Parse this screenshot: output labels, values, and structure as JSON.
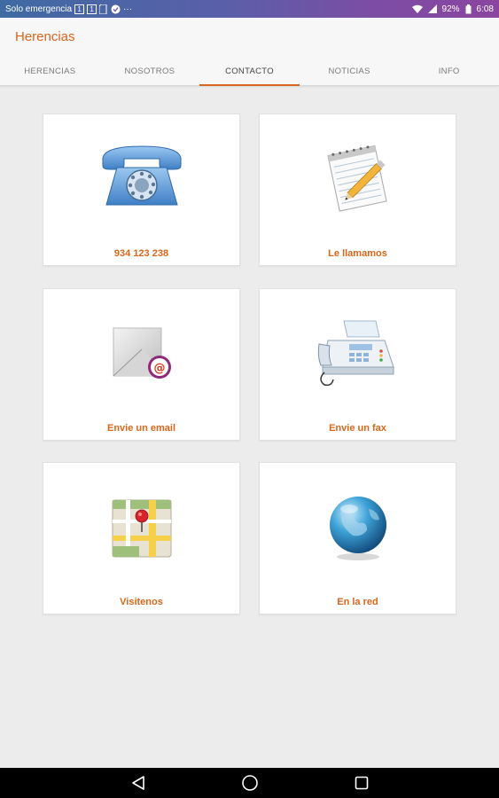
{
  "status_bar": {
    "carrier_text": "Solo emergencia",
    "sim1": "1",
    "sim2": "1",
    "battery": "92%",
    "time": "6:08"
  },
  "app": {
    "title": "Herencias",
    "accent_color": "#d9661a"
  },
  "tabs": [
    {
      "label": "HERENCIAS"
    },
    {
      "label": "NOSOTROS"
    },
    {
      "label": "CONTACTO",
      "active": true
    },
    {
      "label": "NOTICIAS"
    },
    {
      "label": "INFO"
    }
  ],
  "contact_cards": [
    {
      "label": "934 123 238",
      "icon": "telephone-icon"
    },
    {
      "label": "Le llamamos",
      "icon": "notepad-pencil-icon"
    },
    {
      "label": "Envie un email",
      "icon": "email-envelope-icon"
    },
    {
      "label": "Envie un fax",
      "icon": "fax-machine-icon"
    },
    {
      "label": "Visitenos",
      "icon": "map-pin-icon"
    },
    {
      "label": "En la red",
      "icon": "globe-icon"
    }
  ],
  "nav_bar": {
    "back": "back-icon",
    "home": "home-icon",
    "recents": "recents-icon"
  }
}
